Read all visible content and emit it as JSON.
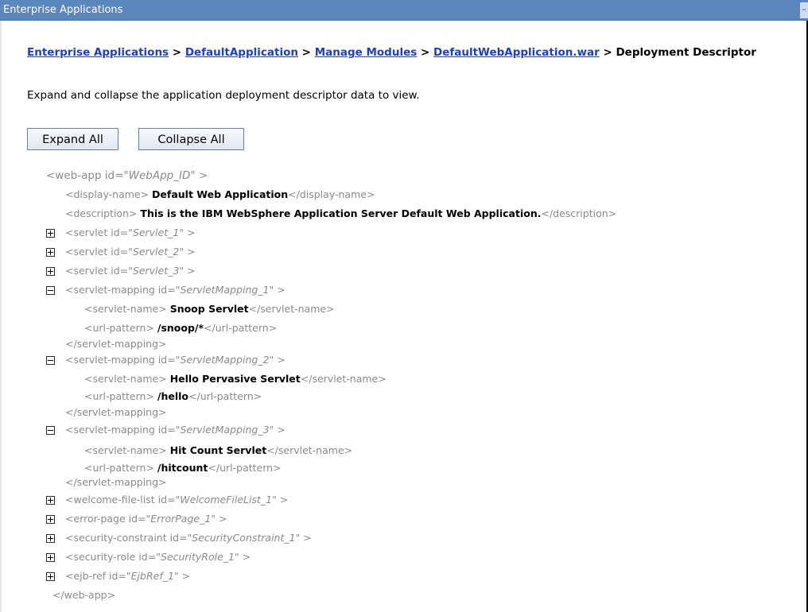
{
  "window": {
    "title": "Enterprise Applications",
    "minimize_glyph": "–"
  },
  "breadcrumb": {
    "links": [
      "Enterprise Applications",
      "DefaultApplication",
      "Manage Modules",
      "DefaultWebApplication.war"
    ],
    "separator": " > ",
    "current": "Deployment Descriptor"
  },
  "description": "Expand and collapse the application deployment descriptor data to view.",
  "buttons": {
    "expand_all": "Expand All",
    "collapse_all": "Collapse All"
  },
  "tree": {
    "webapp_open_prefix": "<web-app id=\"",
    "webapp_id": "WebApp_ID",
    "webapp_open_suffix": "\" >",
    "display_name_open": "<display-name> ",
    "display_name_value": "Default Web Application",
    "display_name_close": "</display-name>",
    "description_open": "<description> ",
    "description_value": "This is the IBM WebSphere Application Server Default Web Application.",
    "description_close": "</description>",
    "servlets": [
      {
        "prefix": "<servlet id=\"",
        "id": "Servlet_1",
        "suffix": "\" >"
      },
      {
        "prefix": "<servlet id=\"",
        "id": "Servlet_2",
        "suffix": "\" >"
      },
      {
        "prefix": "<servlet id=\"",
        "id": "Servlet_3",
        "suffix": "\" >"
      }
    ],
    "mappings": [
      {
        "prefix": "<servlet-mapping id=\"",
        "id": "ServletMapping_1",
        "suffix": "\" >",
        "name_open": "<servlet-name> ",
        "name": "Snoop Servlet",
        "name_close": "</servlet-name>",
        "url_open": "<url-pattern> ",
        "url": "/snoop/*",
        "url_close": "</url-pattern>",
        "close": "</servlet-mapping>"
      },
      {
        "prefix": "<servlet-mapping id=\"",
        "id": "ServletMapping_2",
        "suffix": "\" >",
        "name_open": "<servlet-name> ",
        "name": "Hello Pervasive Servlet",
        "name_close": "</servlet-name>",
        "url_open": "<url-pattern> ",
        "url": "/hello",
        "url_close": "</url-pattern>",
        "close": "</servlet-mapping>"
      },
      {
        "prefix": "<servlet-mapping id=\"",
        "id": "ServletMapping_3",
        "suffix": "\" >",
        "name_open": "<servlet-name> ",
        "name": "Hit Count Servlet",
        "name_close": "</servlet-name>",
        "url_open": "<url-pattern> ",
        "url": "/hitcount",
        "url_close": "</url-pattern>",
        "close": "</servlet-mapping>"
      }
    ],
    "others": [
      {
        "prefix": "<welcome-file-list id=\"",
        "id": "WelcomeFileList_1",
        "suffix": "\" >"
      },
      {
        "prefix": "<error-page id=\"",
        "id": "ErrorPage_1",
        "suffix": "\" >"
      },
      {
        "prefix": "<security-constraint id=\"",
        "id": "SecurityConstraint_1",
        "suffix": "\" >"
      },
      {
        "prefix": "<security-role id=\"",
        "id": "SecurityRole_1",
        "suffix": "\" >"
      },
      {
        "prefix": "<ejb-ref id=\"",
        "id": "EjbRef_1",
        "suffix": "\" >"
      }
    ],
    "webapp_close": "</web-app>"
  }
}
